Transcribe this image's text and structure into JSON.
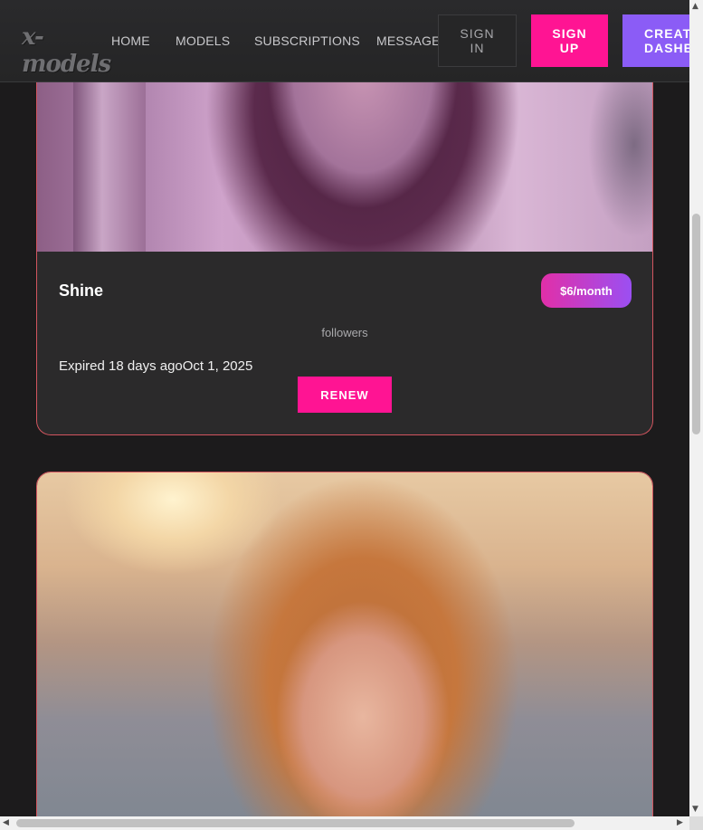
{
  "header": {
    "logo_text": "x-models",
    "nav": [
      {
        "label": "HOME"
      },
      {
        "label": "MODELS"
      },
      {
        "label": "SUBSCRIPTIONS"
      },
      {
        "label": "MESSAGES"
      }
    ],
    "sign_in_label": "SIGN IN",
    "sign_up_label": "SIGN UP",
    "create_label": "CREATE DASHBOARD"
  },
  "subscriptions": [
    {
      "name": "Shine",
      "price": "$6/month",
      "followers_label": "followers",
      "status": "Expired 18 days agoOct 1, 2025",
      "action_label": "RENEW"
    }
  ],
  "colors": {
    "accent_pink": "#ff1493",
    "accent_purple": "#8b5cf6",
    "card_border": "#d2555f",
    "background": "#1c1b1c"
  }
}
